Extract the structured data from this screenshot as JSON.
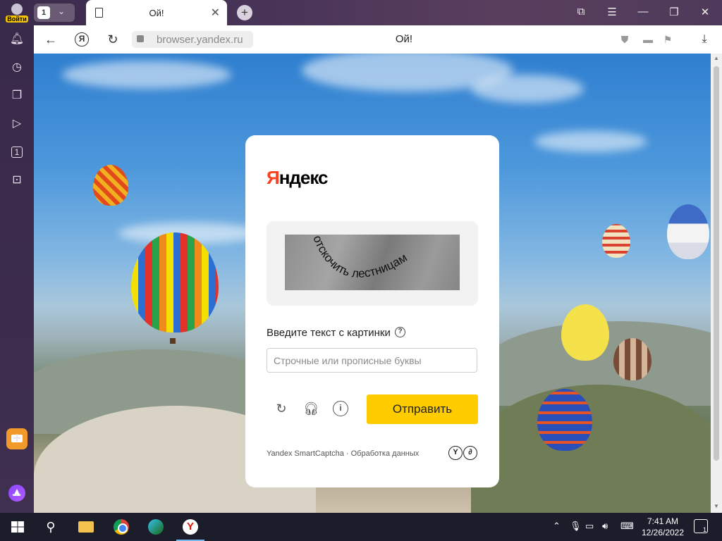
{
  "window": {
    "login_label": "Войти",
    "tab_count": "1",
    "tab_title": "Ой!",
    "close_tab": "✕",
    "new_tab": "+",
    "controls": [
      "⧉",
      "☰",
      "—",
      "❐",
      "✕"
    ]
  },
  "addressbar": {
    "url": "browser.yandex.ru",
    "page_title": "Ой!",
    "ya_button": "Я"
  },
  "sidebar": {
    "icons": [
      "bell-icon",
      "history-icon",
      "collections-icon",
      "video-icon",
      "tab-counter-icon",
      "screenshot-icon"
    ],
    "tab_counter": "1",
    "more": "•••"
  },
  "captcha": {
    "logo_first": "Я",
    "logo_rest": "ндекс",
    "captcha_text": "отскочить лестницам",
    "prompt": "Введите текст с картинки",
    "help": "?",
    "input_placeholder": "Строчные или прописные буквы",
    "input_value": "",
    "submit_label": "Отправить",
    "footer": "Yandex SmartCaptcha · Обработка данных"
  },
  "taskbar": {
    "time": "7:41 AM",
    "date": "12/26/2022",
    "notifications": "1"
  },
  "colors": {
    "accent": "#ffcc00",
    "brand_red": "#fc3f1d",
    "sidebar": "#3a2a4a"
  }
}
